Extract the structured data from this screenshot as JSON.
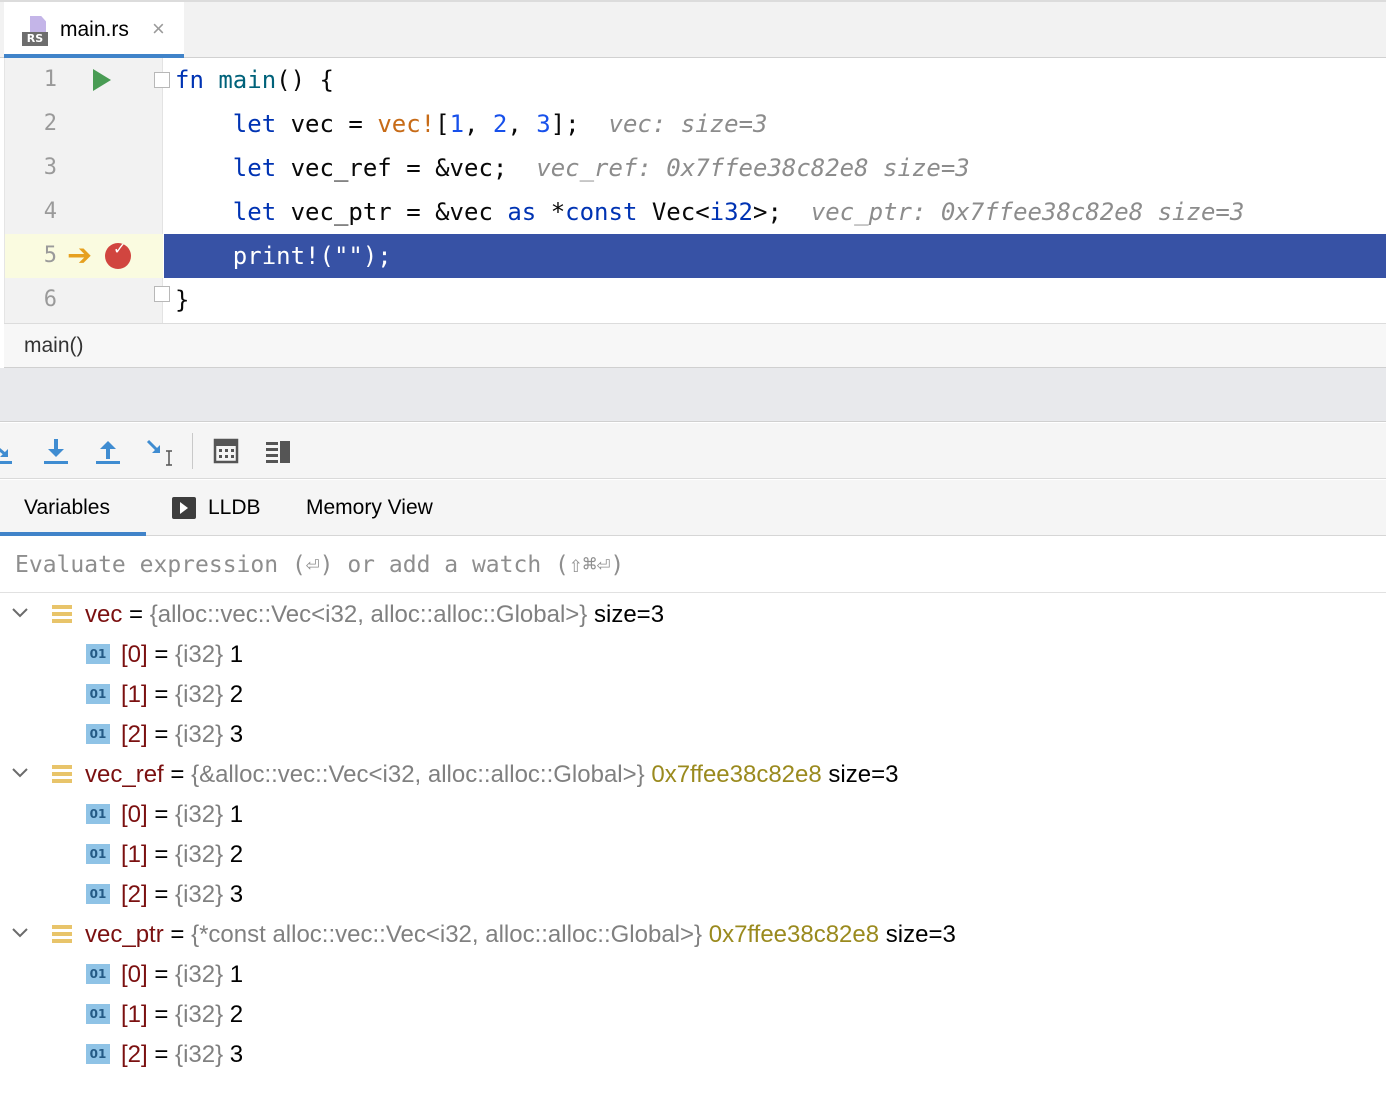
{
  "editor_tab": {
    "icon_badge": "RS",
    "filename": "main.rs",
    "close_glyph": "×"
  },
  "code_lines": [
    {
      "num": "1",
      "code_html": "<span class='kw'>fn</span> <span class='fnname'>main</span>() {"
    },
    {
      "num": "2",
      "code_html": "    <span class='kw'>let</span> vec = <span class='mac'>vec!</span>[<span class='numlit'>1</span>, <span class='numlit'>2</span>, <span class='numlit'>3</span>];  <span class='hint'>vec: size=3</span>"
    },
    {
      "num": "3",
      "code_html": "    <span class='kw'>let</span> vec_ref = &vec;  <span class='hint'>vec_ref: 0x7ffee38c82e8 size=3</span>"
    },
    {
      "num": "4",
      "code_html": "    <span class='kw'>let</span> vec_ptr = &vec <span class='kw'>as</span> *<span class='kw'>const</span> Vec&lt;<span class='kw'>i32</span>&gt;;  <span class='hint'>vec_ptr: 0x7ffee38c82e8 size=3</span>"
    },
    {
      "num": "5",
      "code_html": "    print!(\"\");"
    },
    {
      "num": "6",
      "code_html": "}"
    }
  ],
  "breadcrumb": "main()",
  "debug_toolbar": {
    "buttons": [
      "step-over",
      "step-into",
      "step-out",
      "run-to-cursor",
      "evaluate-expression",
      "layout-settings"
    ]
  },
  "panel_tabs": [
    "Variables",
    "LLDB",
    "Memory View"
  ],
  "evaluate": {
    "placeholder": "Evaluate expression (⏎) or add a watch (⇧⌘⏎)"
  },
  "variables": [
    {
      "name": "vec",
      "type": "{alloc::vec::Vec<i32, alloc::alloc::Global>}",
      "addr": "",
      "summary": "size=3",
      "children": [
        {
          "name": "[0]",
          "type": "{i32}",
          "value": "1"
        },
        {
          "name": "[1]",
          "type": "{i32}",
          "value": "2"
        },
        {
          "name": "[2]",
          "type": "{i32}",
          "value": "3"
        }
      ]
    },
    {
      "name": "vec_ref",
      "type": "{&alloc::vec::Vec<i32, alloc::alloc::Global>}",
      "addr": "0x7ffee38c82e8",
      "summary": "size=3",
      "children": [
        {
          "name": "[0]",
          "type": "{i32}",
          "value": "1"
        },
        {
          "name": "[1]",
          "type": "{i32}",
          "value": "2"
        },
        {
          "name": "[2]",
          "type": "{i32}",
          "value": "3"
        }
      ]
    },
    {
      "name": "vec_ptr",
      "type": "{*const alloc::vec::Vec<i32, alloc::alloc::Global>}",
      "addr": "0x7ffee38c82e8",
      "summary": "size=3",
      "children": [
        {
          "name": "[0]",
          "type": "{i32}",
          "value": "1"
        },
        {
          "name": "[1]",
          "type": "{i32}",
          "value": "2"
        },
        {
          "name": "[2]",
          "type": "{i32}",
          "value": "3"
        }
      ]
    }
  ],
  "colors": {
    "accent": "#4083c9",
    "execution_line": "#3752a5",
    "keyword": "#0033b3",
    "macro": "#c76b17",
    "number": "#1750eb",
    "inlay_hint": "#8c8c8c",
    "var_name": "#7b1010",
    "address": "#9a8a1e",
    "breakpoint": "#d1453f",
    "run_icon": "#499c54"
  },
  "icons": {
    "file": "rust-file-icon",
    "run": "run-icon",
    "fold": "fold-icon",
    "exec_arrow": "execution-point-icon",
    "breakpoint": "breakpoint-icon",
    "lldb": "console-icon",
    "expand": "chevron-down-icon",
    "struct": "list-icon",
    "field": "o1-icon"
  }
}
